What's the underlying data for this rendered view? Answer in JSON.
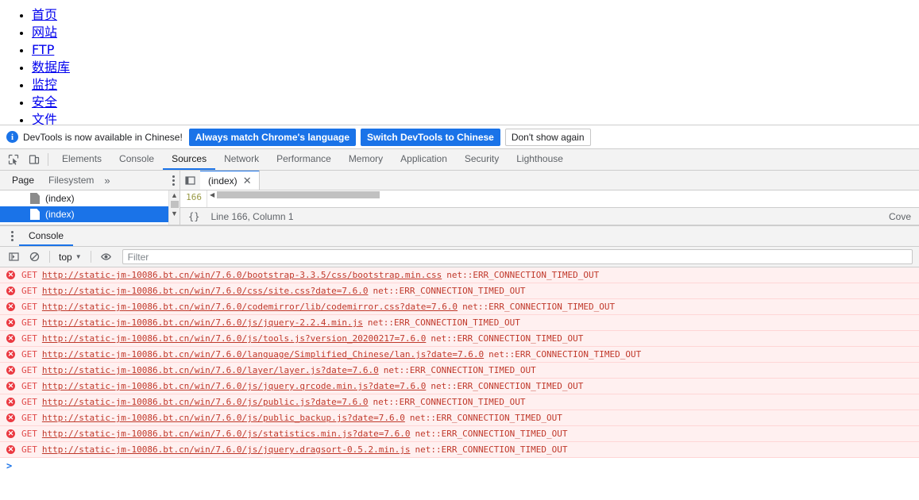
{
  "page": {
    "links": [
      {
        "label": "首页"
      },
      {
        "label": "网站"
      },
      {
        "label": "FTP"
      },
      {
        "label": "数据库"
      },
      {
        "label": "监控"
      },
      {
        "label": "安全"
      },
      {
        "label": "文件"
      }
    ]
  },
  "locale_bar": {
    "icon": "info-icon",
    "message": "DevTools is now available in Chinese!",
    "always_match_label": "Always match Chrome's language",
    "switch_label": "Switch DevTools to Chinese",
    "dismiss_label": "Don't show again"
  },
  "main_tabs": {
    "inspect_icon": "inspect-element-icon",
    "device_icon": "device-toolbar-icon",
    "items": [
      {
        "label": "Elements",
        "active": false
      },
      {
        "label": "Console",
        "active": false
      },
      {
        "label": "Sources",
        "active": true
      },
      {
        "label": "Network",
        "active": false
      },
      {
        "label": "Performance",
        "active": false
      },
      {
        "label": "Memory",
        "active": false
      },
      {
        "label": "Application",
        "active": false
      },
      {
        "label": "Security",
        "active": false
      },
      {
        "label": "Lighthouse",
        "active": false
      }
    ]
  },
  "sources": {
    "nav_tabs": [
      {
        "label": "Page",
        "active": true
      },
      {
        "label": "Filesystem",
        "active": false
      }
    ],
    "more_tabs_icon": "chevron-double-right-icon",
    "more_options_icon": "more-options-icon",
    "files": [
      {
        "label": "(index)",
        "selected": false
      },
      {
        "label": "(index)",
        "selected": true
      }
    ],
    "editor": {
      "panel_toggle_icon": "toggle-navigator-icon",
      "tab_label": "(index)",
      "close_icon": "close-icon",
      "line_number": "166",
      "format_icon": "{}",
      "position_label": "Line 166, Column 1",
      "coverage_label": "Cove"
    }
  },
  "drawer": {
    "more_tools_icon": "more-tools-icon",
    "tab_label": "Console",
    "toolbar": {
      "sidebar_icon": "console-sidebar-icon",
      "clear_icon": "clear-console-icon",
      "context": "top",
      "caret": "▼",
      "eye_icon": "live-expression-icon",
      "filter_placeholder": "Filter"
    },
    "prompt": ">",
    "messages": [
      {
        "icon": "error-icon",
        "method": "GET",
        "url": "http://static-jm-10086.bt.cn/win/7.6.0/bootstrap-3.3.5/css/bootstrap.min.css",
        "error": "net::ERR_CONNECTION_TIMED_OUT"
      },
      {
        "icon": "error-icon",
        "method": "GET",
        "url": "http://static-jm-10086.bt.cn/win/7.6.0/css/site.css?date=7.6.0",
        "error": "net::ERR_CONNECTION_TIMED_OUT"
      },
      {
        "icon": "error-icon",
        "method": "GET",
        "url": "http://static-jm-10086.bt.cn/win/7.6.0/codemirror/lib/codemirror.css?date=7.6.0",
        "error": "net::ERR_CONNECTION_TIMED_OUT"
      },
      {
        "icon": "error-icon",
        "method": "GET",
        "url": "http://static-jm-10086.bt.cn/win/7.6.0/js/jquery-2.2.4.min.js",
        "error": "net::ERR_CONNECTION_TIMED_OUT"
      },
      {
        "icon": "error-icon",
        "method": "GET",
        "url": "http://static-jm-10086.bt.cn/win/7.6.0/js/tools.js?version_20200217=7.6.0",
        "error": "net::ERR_CONNECTION_TIMED_OUT"
      },
      {
        "icon": "error-icon",
        "method": "GET",
        "url": "http://static-jm-10086.bt.cn/win/7.6.0/language/Simplified_Chinese/lan.js?date=7.6.0",
        "error": "net::ERR_CONNECTION_TIMED_OUT"
      },
      {
        "icon": "error-icon",
        "method": "GET",
        "url": "http://static-jm-10086.bt.cn/win/7.6.0/layer/layer.js?date=7.6.0",
        "error": "net::ERR_CONNECTION_TIMED_OUT"
      },
      {
        "icon": "error-icon",
        "method": "GET",
        "url": "http://static-jm-10086.bt.cn/win/7.6.0/js/jquery.qrcode.min.js?date=7.6.0",
        "error": "net::ERR_CONNECTION_TIMED_OUT"
      },
      {
        "icon": "error-icon",
        "method": "GET",
        "url": "http://static-jm-10086.bt.cn/win/7.6.0/js/public.js?date=7.6.0",
        "error": "net::ERR_CONNECTION_TIMED_OUT"
      },
      {
        "icon": "error-icon",
        "method": "GET",
        "url": "http://static-jm-10086.bt.cn/win/7.6.0/js/public_backup.js?date=7.6.0",
        "error": "net::ERR_CONNECTION_TIMED_OUT"
      },
      {
        "icon": "error-icon",
        "method": "GET",
        "url": "http://static-jm-10086.bt.cn/win/7.6.0/js/statistics.min.js?date=7.6.0",
        "error": "net::ERR_CONNECTION_TIMED_OUT"
      },
      {
        "icon": "error-icon",
        "method": "GET",
        "url": "http://static-jm-10086.bt.cn/win/7.6.0/js/jquery.dragsort-0.5.2.min.js",
        "error": "net::ERR_CONNECTION_TIMED_OUT"
      }
    ]
  },
  "colors": {
    "accent": "#1a73e8",
    "error_text": "#c0392b",
    "error_bg": "#fff0f0",
    "link": "#0000ee"
  }
}
